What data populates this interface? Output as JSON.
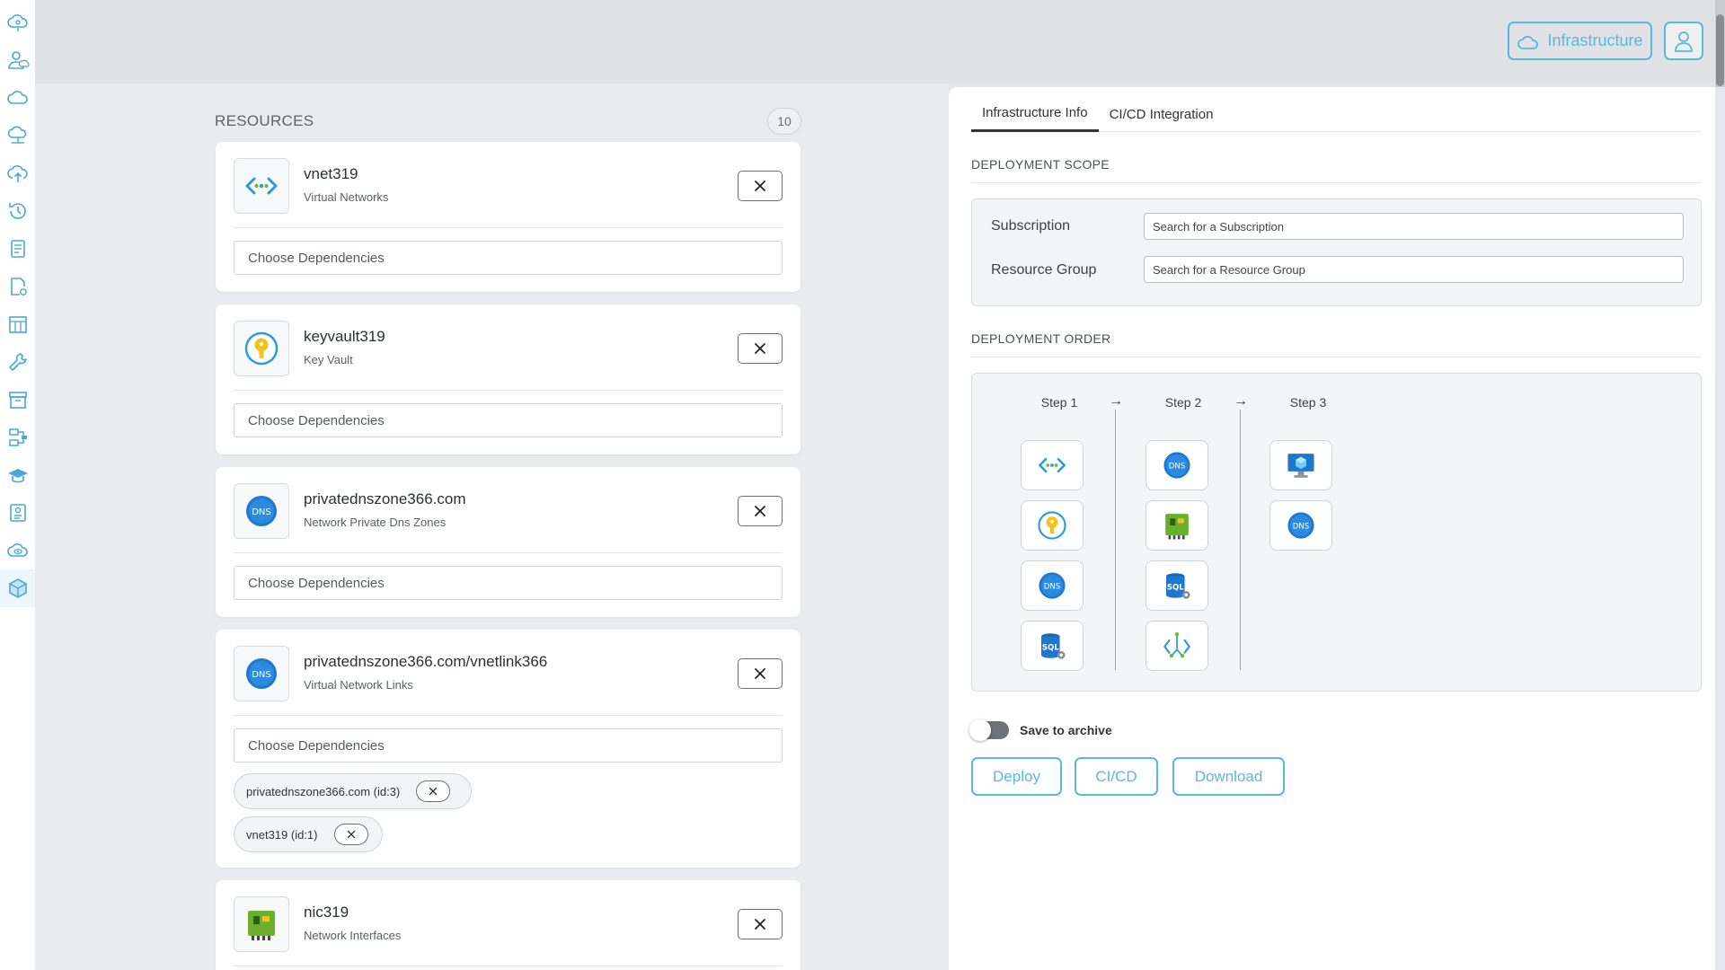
{
  "header": {
    "infrastructure_label": "Infrastructure"
  },
  "sidebar": {
    "items": [
      {
        "icon": "cloud-brain-icon"
      },
      {
        "icon": "user-cloud-icon"
      },
      {
        "icon": "cloud-icon"
      },
      {
        "icon": "cloud-network-icon"
      },
      {
        "icon": "cloud-upload-icon"
      },
      {
        "icon": "history-icon"
      },
      {
        "icon": "document-list-icon"
      },
      {
        "icon": "document-settings-icon"
      },
      {
        "icon": "building-icon"
      },
      {
        "icon": "wrench-icon"
      },
      {
        "icon": "archive-icon"
      },
      {
        "icon": "pipeline-icon"
      },
      {
        "icon": "graduation-cap-icon"
      },
      {
        "icon": "resume-icon"
      },
      {
        "icon": "cloud-eye-icon"
      },
      {
        "icon": "cube-icon"
      }
    ]
  },
  "resources": {
    "title": "RESOURCES",
    "count": "10",
    "dependency_placeholder": "Choose Dependencies",
    "items": [
      {
        "name": "vnet319",
        "type": "Virtual Networks",
        "icon": "vnet-icon"
      },
      {
        "name": "keyvault319",
        "type": "Key Vault",
        "icon": "key-vault-icon"
      },
      {
        "name": "privatednszone366.com",
        "type": "Network Private Dns Zones",
        "icon": "dns-icon"
      },
      {
        "name": "privatednszone366.com/vnetlink366",
        "type": "Virtual Network Links",
        "icon": "dns-icon",
        "dependencies": [
          "privatednszone366.com (id:3)",
          "vnet319 (id:1)"
        ]
      },
      {
        "name": "nic319",
        "type": "Network Interfaces",
        "icon": "nic-icon"
      }
    ]
  },
  "panel": {
    "tabs": [
      "Infrastructure Info",
      "CI/CD Integration"
    ],
    "active_tab": "Infrastructure Info",
    "deployment_scope": {
      "title": "DEPLOYMENT SCOPE",
      "subscription_label": "Subscription",
      "subscription_placeholder": "Search for a Subscription",
      "resource_group_label": "Resource Group",
      "resource_group_placeholder": "Search for a Resource Group"
    },
    "deployment_order": {
      "title": "DEPLOYMENT ORDER",
      "steps": [
        {
          "label": "Step 1",
          "icons": [
            "vnet-icon",
            "key-vault-icon",
            "dns-icon",
            "sql-icon"
          ]
        },
        {
          "label": "Step 2",
          "icons": [
            "dns-icon",
            "nic-icon",
            "sql-icon",
            "lb-icon"
          ]
        },
        {
          "label": "Step 3",
          "icons": [
            "vm-icon",
            "dns-icon"
          ]
        }
      ]
    },
    "archive": {
      "label": "Save to archive",
      "enabled": false
    },
    "buttons": {
      "deploy": "Deploy",
      "cicd": "CI/CD",
      "download": "Download"
    }
  },
  "colors": {
    "accent": "#5bb8dd",
    "background": "#e9ebee",
    "card": "#ffffff"
  }
}
